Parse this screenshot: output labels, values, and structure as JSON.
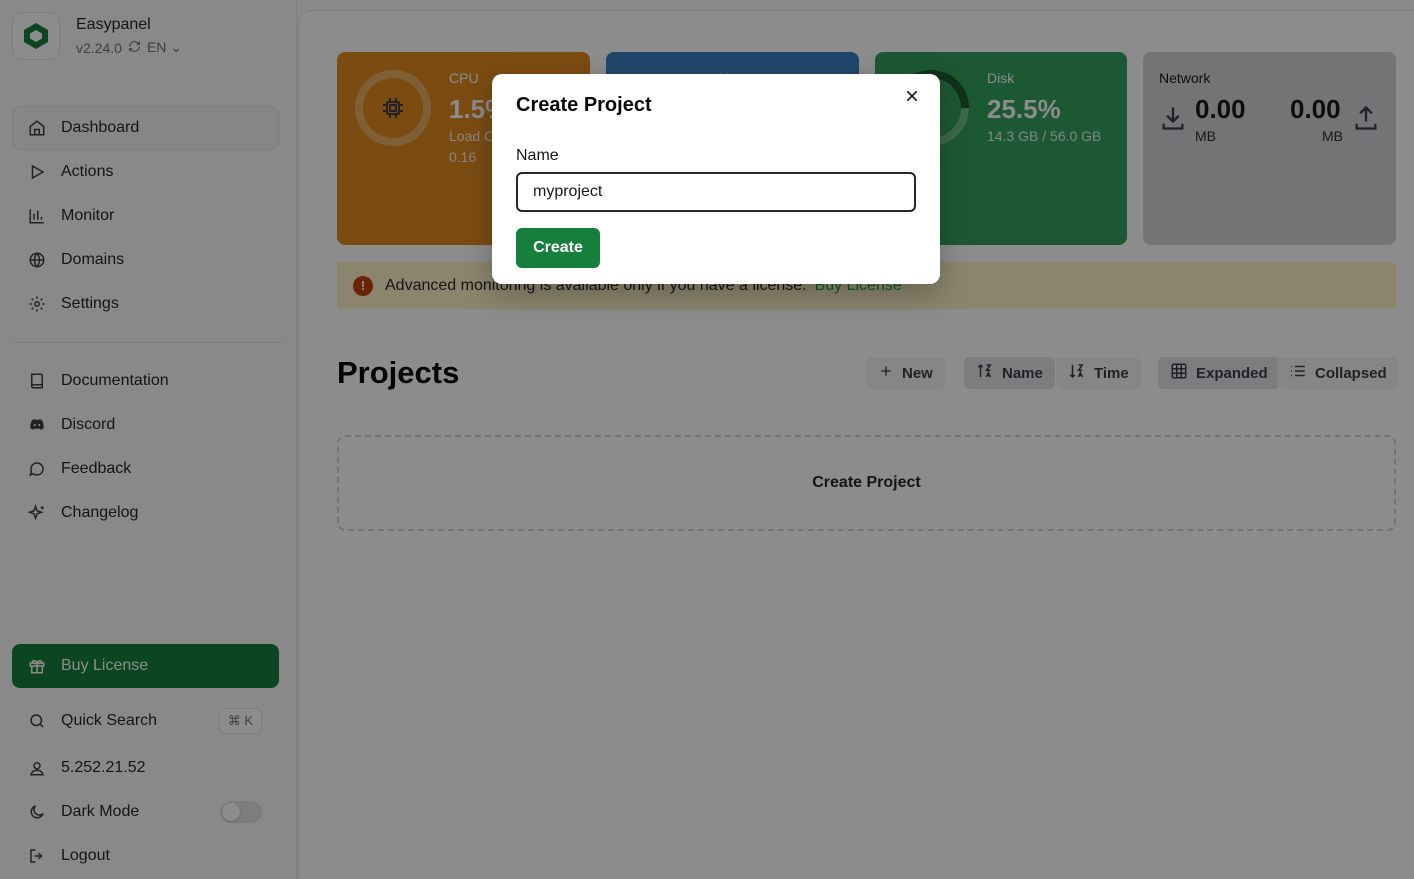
{
  "app": {
    "name": "Easypanel",
    "version": "v2.24.0",
    "language": "EN"
  },
  "sidebar": {
    "nav": [
      {
        "label": "Dashboard",
        "icon": "home-icon",
        "active": true
      },
      {
        "label": "Actions",
        "icon": "play-icon"
      },
      {
        "label": "Monitor",
        "icon": "bar-chart-icon"
      },
      {
        "label": "Domains",
        "icon": "globe-icon"
      },
      {
        "label": "Settings",
        "icon": "gear-icon"
      }
    ],
    "links": [
      {
        "label": "Documentation",
        "icon": "book-icon"
      },
      {
        "label": "Discord",
        "icon": "discord-icon"
      },
      {
        "label": "Feedback",
        "icon": "message-icon"
      },
      {
        "label": "Changelog",
        "icon": "sparkles-icon"
      }
    ],
    "buy_license": "Buy License",
    "quick_search": "Quick Search",
    "quick_search_shortcut": "⌘ K",
    "ip": "5.252.21.52",
    "dark_mode": "Dark Mode",
    "logout": "Logout"
  },
  "stats": {
    "cpu": {
      "label": "CPU",
      "value": "1.5%",
      "sub_label": "Load C",
      "sub_value": "0.16",
      "color": "#c2731e"
    },
    "memory": {
      "label": "M",
      "color": "#2f6aa6"
    },
    "disk": {
      "label": "Disk",
      "value": "25.5%",
      "sub": "14.3 GB / 56.0 GB",
      "color": "#2a8a4e"
    },
    "network": {
      "label": "Network",
      "down_value": "0.00",
      "down_unit": "MB",
      "up_value": "0.00",
      "up_unit": "MB",
      "color": "#a1a1aa"
    }
  },
  "alert": {
    "text": "Advanced monitoring is available only if you have a license.",
    "link": "Buy License"
  },
  "projects": {
    "title": "Projects",
    "new_label": "New",
    "sort_name": "Name",
    "sort_time": "Time",
    "view_expanded": "Expanded",
    "view_collapsed": "Collapsed",
    "empty_label": "Create Project"
  },
  "modal": {
    "title": "Create Project",
    "field_label": "Name",
    "field_value": "myproject",
    "submit_label": "Create"
  }
}
